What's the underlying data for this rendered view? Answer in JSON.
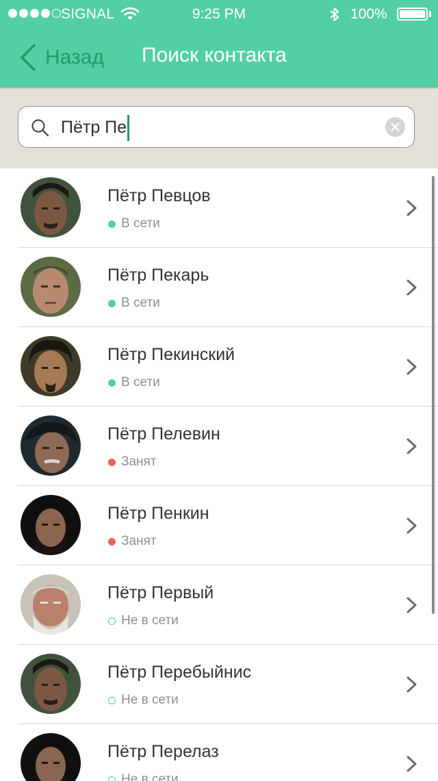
{
  "status_bar": {
    "carrier": "SIGNAL",
    "time": "9:25 PM",
    "battery": "100%",
    "battery_level": 1.0,
    "signal_bars": 4,
    "signal_total": 5
  },
  "nav": {
    "back_label": "Назад",
    "title": "Поиск контакта"
  },
  "search": {
    "value": "Пётр Пе",
    "icon": "search-icon",
    "clear_icon": "clear-icon"
  },
  "colors": {
    "accent": "#53d0a3",
    "accent_dark": "#1a9e6b",
    "online": "#53d0a3",
    "busy": "#ec6355"
  },
  "contacts": [
    {
      "name": "Пётр Певцов",
      "status": "В сети",
      "state": "online"
    },
    {
      "name": "Пётр Пекарь",
      "status": "В сети",
      "state": "online"
    },
    {
      "name": "Пётр Пекинский",
      "status": "В сети",
      "state": "online"
    },
    {
      "name": "Пётр Пелевин",
      "status": "Занят",
      "state": "busy"
    },
    {
      "name": "Пётр Пенкин",
      "status": "Занят",
      "state": "busy"
    },
    {
      "name": "Пётр Первый",
      "status": "Не в сети",
      "state": "offline"
    },
    {
      "name": "Пётр Перебыйнис",
      "status": "Не в сети",
      "state": "offline"
    },
    {
      "name": "Пётр Перелаз",
      "status": "Не в сети",
      "state": "offline"
    }
  ]
}
